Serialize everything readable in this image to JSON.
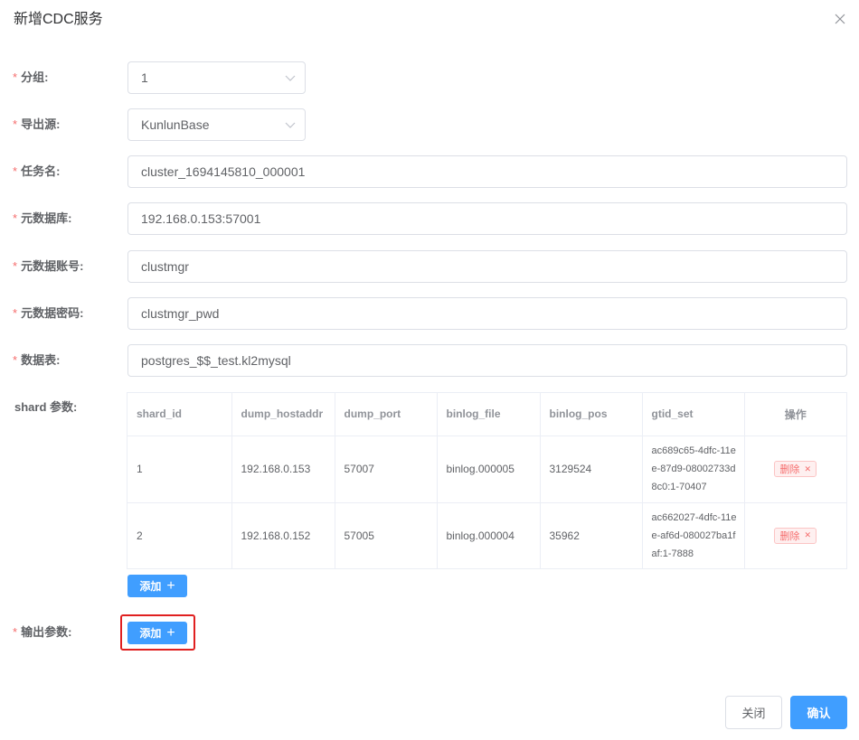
{
  "dialog": {
    "title": "新增CDC服务"
  },
  "form": {
    "required_mark": "*",
    "group": {
      "label": "分组:",
      "value": "1"
    },
    "source": {
      "label": "导出源:",
      "value": "KunlunBase"
    },
    "task_name": {
      "label": "任务名:",
      "value": "cluster_1694145810_000001"
    },
    "meta_db": {
      "label": "元数据库:",
      "value": "192.168.0.153:57001"
    },
    "meta_user": {
      "label": "元数据账号:",
      "value": "clustmgr"
    },
    "meta_password": {
      "label": "元数据密码:",
      "value": "clustmgr_pwd"
    },
    "data_table": {
      "label": "数据表:",
      "value": "postgres_$$_test.kl2mysql"
    },
    "shard_params": {
      "label": "shard 参数:"
    },
    "output_params": {
      "label": "输出参数:"
    }
  },
  "shard_table": {
    "headers": [
      "shard_id",
      "dump_hostaddr",
      "dump_port",
      "binlog_file",
      "binlog_pos",
      "gtid_set",
      "操作"
    ],
    "rows": [
      {
        "shard_id": "1",
        "dump_hostaddr": "192.168.0.153",
        "dump_port": "57007",
        "binlog_file": "binlog.000005",
        "binlog_pos": "3129524",
        "gtid_set": "ac689c65-4dfc-11ee-87d9-08002733d8c0:1-70407",
        "delete_label": "删除"
      },
      {
        "shard_id": "2",
        "dump_hostaddr": "192.168.0.152",
        "dump_port": "57005",
        "binlog_file": "binlog.000004",
        "binlog_pos": "35962",
        "gtid_set": "ac662027-4dfc-11ee-af6d-080027ba1faf:1-7888",
        "delete_label": "删除"
      }
    ]
  },
  "buttons": {
    "add_shard": "添加",
    "add_output": "添加",
    "close": "关闭",
    "confirm": "确认"
  },
  "colors": {
    "primary": "#409eff",
    "danger": "#f56c6c",
    "highlight": "#e02020"
  }
}
